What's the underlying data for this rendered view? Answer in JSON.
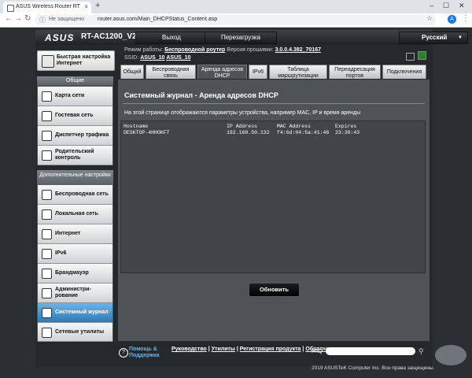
{
  "browser": {
    "tab_title": "ASUS Wireless Router RT-AC120",
    "tab_close": "×",
    "new_tab": "+",
    "security": "Не защищено",
    "url": "router.asus.com/Main_DHCPStatus_Content.asp",
    "avatar_letter": "A",
    "minimize": "–",
    "maximize": "☐",
    "close": "✕"
  },
  "header": {
    "logo": "ASUS",
    "model": "RT-AC1200_V2",
    "logout_label": "Выход",
    "reboot_label": "Перезагрузка",
    "language": "Русский"
  },
  "status": {
    "mode_label": "Режим работы:",
    "mode_value": "Беспроводной роутер",
    "firmware_label": "Версия прошивки:",
    "firmware_value": "3.0.0.4.382_70167",
    "ssid_label": "SSID:",
    "ssid1": "ASUS_10",
    "ssid2": "ASUS_10"
  },
  "sidebar": {
    "quick_setup": "Быстрая настройка Интернет",
    "general_title": "Общие",
    "general_items": [
      {
        "label": "Карта сети"
      },
      {
        "label": "Гостевая сеть"
      },
      {
        "label": "Диспетчер трафика"
      },
      {
        "label": "Родительский контроль"
      }
    ],
    "advanced_title": "Дополнительные настройки",
    "advanced_items": [
      {
        "label": "Беспроводная сеть"
      },
      {
        "label": "Локальная сеть"
      },
      {
        "label": "Интернет"
      },
      {
        "label": "IPv6"
      },
      {
        "label": "Брандмауэр"
      },
      {
        "label": "Администри-рование"
      },
      {
        "label": "Системный журнал"
      },
      {
        "label": "Сетевые утилиты"
      }
    ]
  },
  "tabs": [
    {
      "label": "Общий"
    },
    {
      "label": "Беспроводная связь"
    },
    {
      "label": "Аренда адресов DHCP"
    },
    {
      "label": "IPv6"
    },
    {
      "label": "Таблица маршрутизации"
    },
    {
      "label": "Переадресация портов"
    },
    {
      "label": "Подключения"
    }
  ],
  "main": {
    "title": "Системный журнал - Аренда адресов DHCP",
    "description": "На этой странице отображаются параметры устройства, например MAC, IP и время аренды",
    "columns": [
      "Hostname",
      "IP Address",
      "MAC Address",
      "Expires"
    ],
    "rows": [
      [
        "DESKTOP-4HHOKFT",
        "192.168.50.132",
        "f4:6d:04:5a:41:46",
        "23:30:43"
      ]
    ],
    "refresh_label": "Обновить"
  },
  "footer": {
    "help_icon": "?",
    "help_text": "Помощь & Поддержка",
    "link_manual": "Руководство",
    "link_utils": "Утилиты",
    "link_reg": "Регистрация продукта",
    "link_feedback": "Обратная связь",
    "faq": "FAQ",
    "copyright": "2019 ASUSTeK Computer Inc. Все права защищены."
  }
}
